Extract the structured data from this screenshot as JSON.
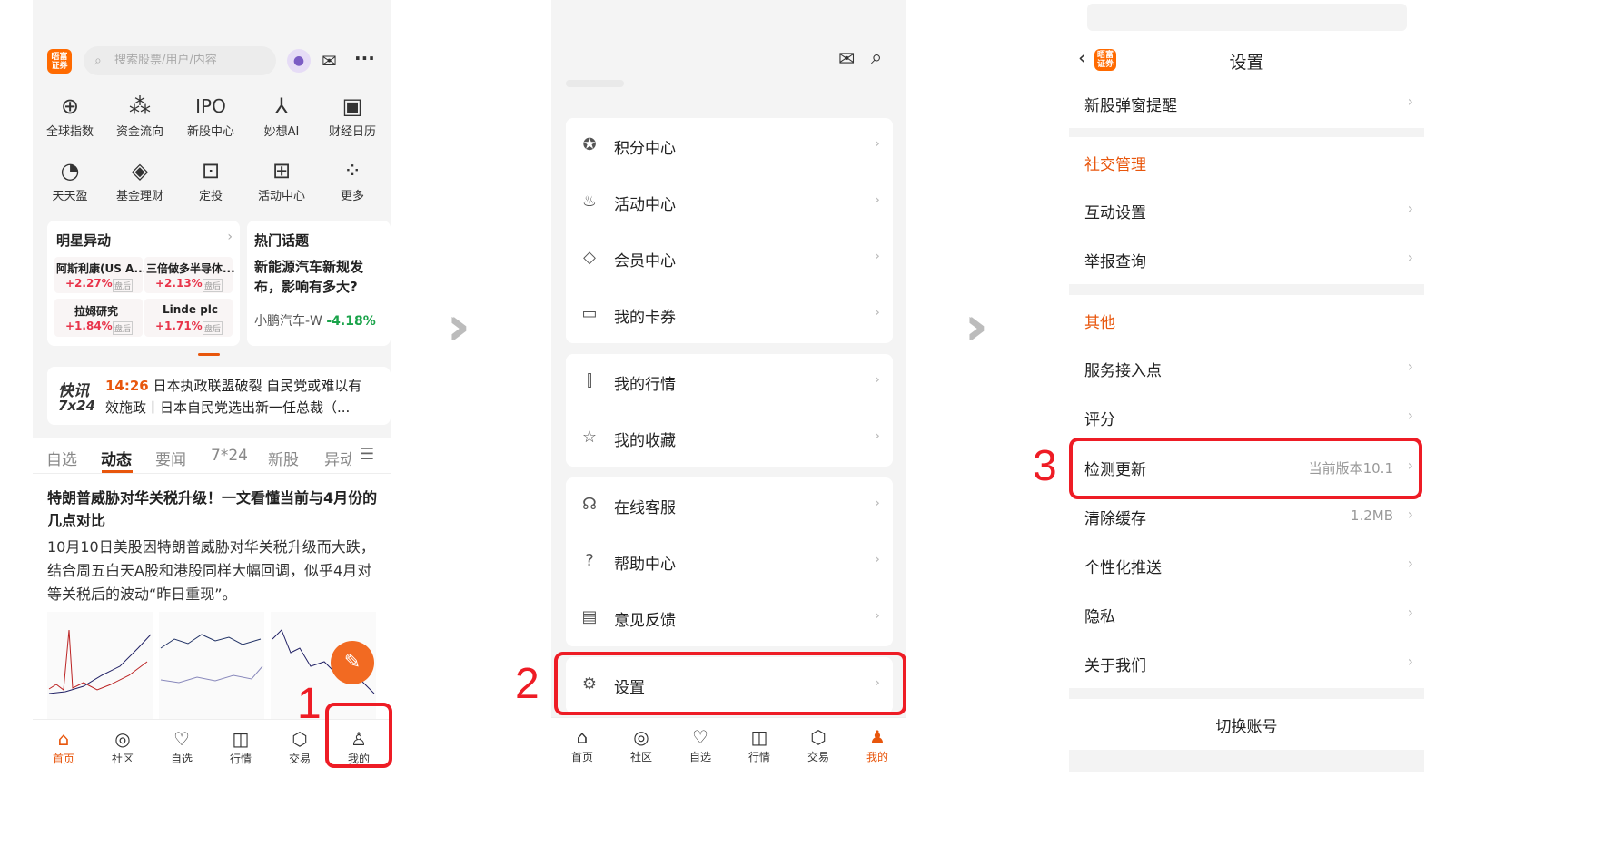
{
  "p1": {
    "logo_text": "晤富证券",
    "search_placeholder": "搜索股票/用户/内容",
    "quick_row1": [
      "全球指数",
      "资金流向",
      "新股中心",
      "妙想AI",
      "财经日历"
    ],
    "quick_row2": [
      "天天盈",
      "基金理财",
      "定投",
      "活动中心",
      "更多"
    ],
    "star_card": {
      "title": "明星异动",
      "items": [
        {
          "name": "阿斯利康(US A...",
          "change": "+2.27%",
          "tag": "盘后"
        },
        {
          "name": "三倍做多半导体...",
          "change": "+2.13%",
          "tag": "盘后"
        },
        {
          "name": "拉姆研究",
          "change": "+1.84%",
          "tag": "盘后"
        },
        {
          "name": "Linde plc",
          "change": "+1.71%",
          "tag": "盘后"
        }
      ]
    },
    "hot_card": {
      "title": "热门话题",
      "headline": "新能源汽车新规发布，影响有多大?",
      "stock": "小鹏汽车-W",
      "change": "-4.18%"
    },
    "flash": {
      "logo1": "快讯",
      "logo2": "7x24",
      "time": "14:26",
      "line1": "日本执政联盟破裂 自民党或难以有",
      "line2": "效施政丨日本自民党选出新一任总裁（..."
    },
    "tabs": [
      "自选",
      "动态",
      "要闻",
      "7*24",
      "新股",
      "异动"
    ],
    "article": {
      "title": "特朗普威胁对华关税升级！一文看懂当前与4月份的几点对比",
      "body": "10月10日美股因特朗普威胁对华关税升级而大跌，结合周五白天A股和港股同样大幅回调，似乎4月对等关税后的波动“昨日重现”。"
    },
    "nav": [
      "首页",
      "社区",
      "自选",
      "行情",
      "交易",
      "我的"
    ],
    "step_label": "1"
  },
  "p2": {
    "group1": [
      "积分中心",
      "活动中心",
      "会员中心",
      "我的卡券"
    ],
    "group2": [
      "我的行情",
      "我的收藏"
    ],
    "group3": [
      "在线客服",
      "帮助中心",
      "意见反馈"
    ],
    "settings_label": "设置",
    "nav": [
      "首页",
      "社区",
      "自选",
      "行情",
      "交易",
      "我的"
    ],
    "step_label": "2"
  },
  "p3": {
    "title": "设置",
    "logo_text": "晤富证券",
    "rows_top": [
      "新股弹窗提醒"
    ],
    "section_social": "社交管理",
    "social_rows": [
      "互动设置",
      "举报查询"
    ],
    "section_other": "其他",
    "other_rows": [
      "服务接入点",
      "评分"
    ],
    "check_update": {
      "label": "检测更新",
      "value": "当前版本10.1"
    },
    "clear_cache": {
      "label": "清除缓存",
      "value": "1.2MB"
    },
    "rows_bottom": [
      "个性化推送",
      "隐私",
      "关于我们"
    ],
    "switch_account": "切换账号",
    "step_label": "3"
  },
  "colors": {
    "accent": "#e8560c",
    "highlight_box": "#ee1c25",
    "up": "#e8344a",
    "down": "#1aa34a"
  }
}
